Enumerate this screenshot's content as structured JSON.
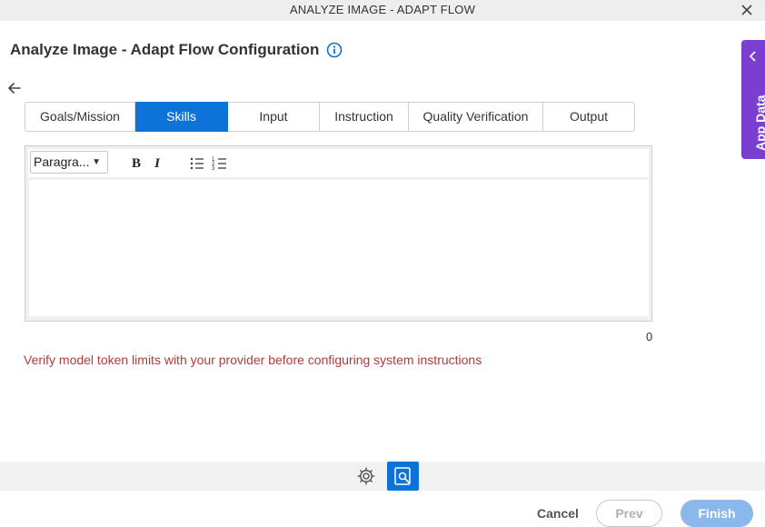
{
  "window": {
    "title": "ANALYZE IMAGE - ADAPT FLOW"
  },
  "page": {
    "title": "Analyze Image - Adapt Flow Configuration"
  },
  "tabs": [
    {
      "label": "Goals/Mission",
      "active": false
    },
    {
      "label": "Skills",
      "active": true
    },
    {
      "label": "Input",
      "active": false
    },
    {
      "label": "Instruction",
      "active": false
    },
    {
      "label": "Quality Verification",
      "active": false
    },
    {
      "label": "Output",
      "active": false
    }
  ],
  "editor": {
    "format_value": "Paragra...",
    "bold_label": "B",
    "italic_label": "I",
    "content": "",
    "char_count": "0"
  },
  "warning": "Verify model token limits with your provider before configuring system instructions",
  "side_panel": {
    "label": "App Data"
  },
  "footer": {
    "cancel_label": "Cancel",
    "prev_label": "Prev",
    "finish_label": "Finish"
  },
  "colors": {
    "accent": "#0d73d9",
    "side_panel": "#7a3fd1",
    "warning": "#b23b3b",
    "finish_disabled": "#8ab8ea"
  },
  "icons": [
    "close-icon",
    "info-icon",
    "back-arrow-icon",
    "bulleted-list-icon",
    "numbered-list-icon",
    "chevron-left-icon",
    "gear-icon",
    "preview-icon"
  ]
}
